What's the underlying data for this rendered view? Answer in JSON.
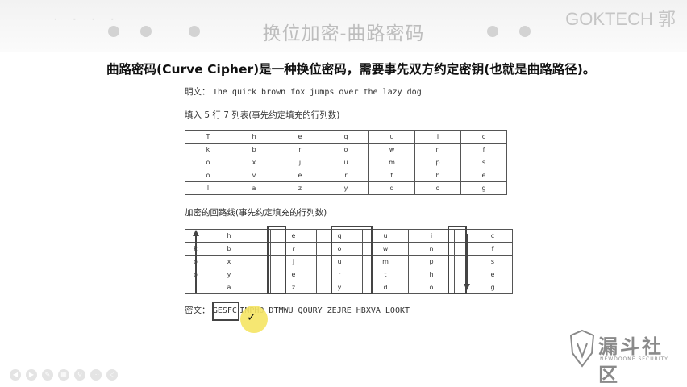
{
  "header": {
    "title": "换位加密-曲路密码",
    "brand": "GOKTECH 郭",
    "faint_text": "· · · ·"
  },
  "intro": "曲路密码(Curve Cipher)是一种换位密码，需要事先双方约定密钥(也就是曲路路径)。",
  "plaintext": {
    "label": "明文：",
    "value": "The quick brown fox jumps over the lazy dog"
  },
  "fill_note": "填入 5 行 7 列表(事先约定填充的行列数)",
  "route_note": "加密的回路线(事先约定填充的行列数)",
  "grid": [
    [
      "T",
      "h",
      "e",
      "q",
      "u",
      "i",
      "c"
    ],
    [
      "k",
      "b",
      "r",
      "o",
      "w",
      "n",
      "f"
    ],
    [
      "o",
      "x",
      "j",
      "u",
      "m",
      "p",
      "s"
    ],
    [
      "o",
      "v",
      "e",
      "r",
      "t",
      "h",
      "e"
    ],
    [
      "l",
      "a",
      "z",
      "y",
      "d",
      "o",
      "g"
    ]
  ],
  "grid2": [
    [
      "T",
      "h",
      "",
      "e",
      "q",
      "u",
      "i",
      "",
      "c"
    ],
    [
      "k",
      "b",
      "",
      "r",
      "o",
      "w",
      "n",
      "",
      "f"
    ],
    [
      "o",
      "x",
      "",
      "j",
      "u",
      "m",
      "p",
      "",
      "s"
    ],
    [
      "o",
      "y",
      "",
      "e",
      "r",
      "t",
      "h",
      "",
      "e"
    ],
    [
      "l",
      "a",
      "",
      "z",
      "y",
      "d",
      "o",
      "",
      "g"
    ]
  ],
  "ciphertext": {
    "label": "密文：",
    "first": "GESFC",
    "rest": "INPHO DTMWU QOURY ZEJRE HBXVA LOOKT"
  },
  "logo": {
    "name": "漏斗社区",
    "sub": "NEWDOONE SECURITY"
  },
  "colors": {
    "highlight": "#f5e463",
    "border": "#444444"
  }
}
